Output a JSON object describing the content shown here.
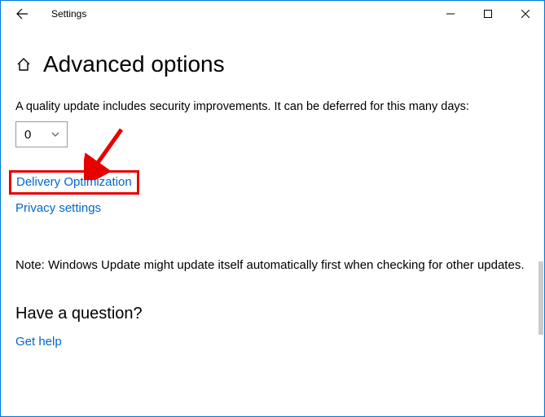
{
  "titlebar": {
    "title": "Settings"
  },
  "header": {
    "title": "Advanced options"
  },
  "main": {
    "quality_desc": "A quality update includes security improvements. It can be deferred for this many days:",
    "defer_value": "0",
    "link_delivery": "Delivery Optimization",
    "link_privacy": "Privacy settings",
    "note": "Note: Windows Update might update itself automatically first when checking for other updates."
  },
  "help": {
    "heading": "Have a question?",
    "link": "Get help"
  }
}
